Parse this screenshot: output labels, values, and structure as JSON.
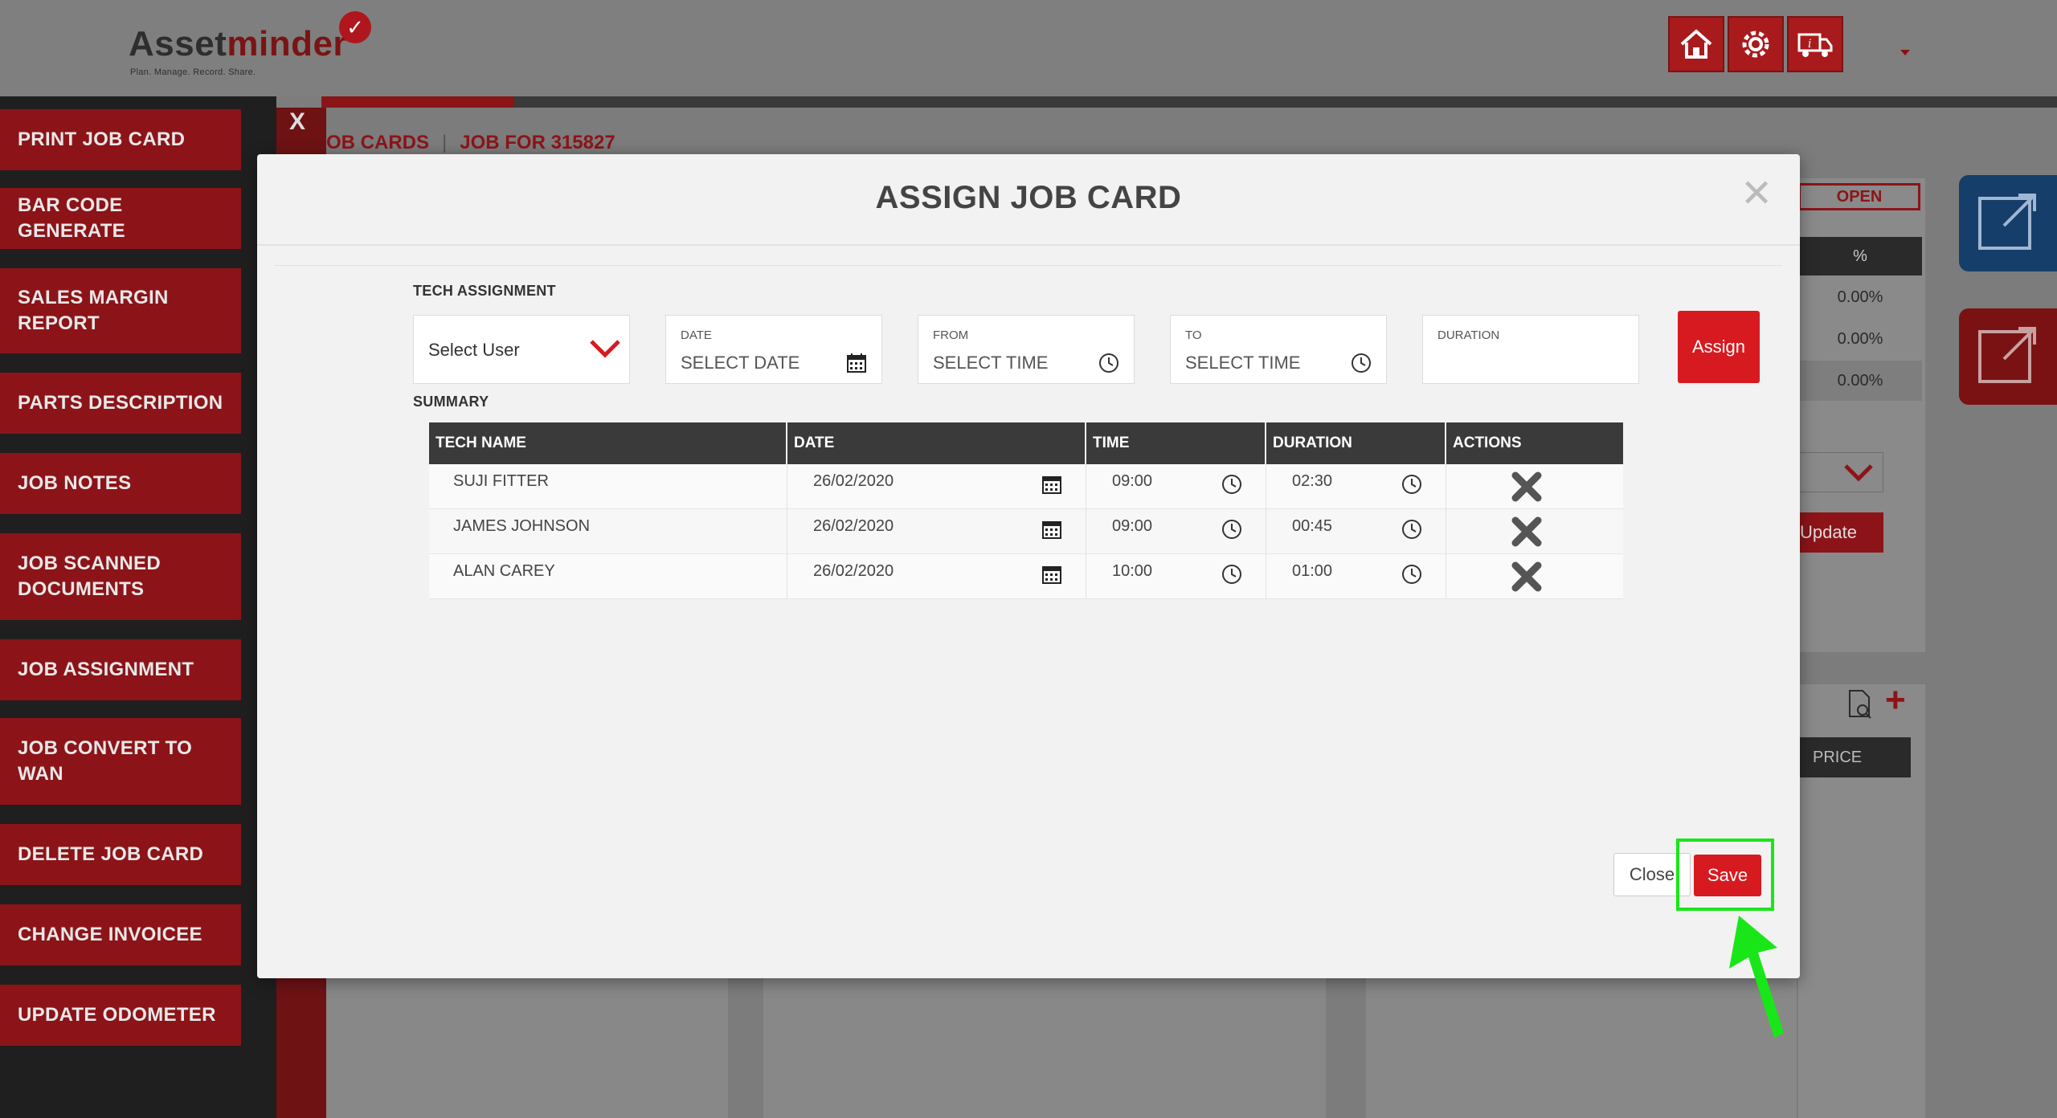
{
  "header": {
    "logo_word_a": "Asset",
    "logo_word_b": "minder",
    "logo_tagline": "Plan. Manage. Record. Share.",
    "nav_icons": [
      "home-icon",
      "gear-icon",
      "truck-info-icon"
    ]
  },
  "sidebar": {
    "close_label": "X",
    "items": [
      {
        "label": "PRINT JOB CARD"
      },
      {
        "label": "BAR CODE GENERATE"
      },
      {
        "label": "SALES MARGIN REPORT"
      },
      {
        "label": "PARTS DESCRIPTION"
      },
      {
        "label": "JOB NOTES"
      },
      {
        "label": "JOB SCANNED DOCUMENTS"
      },
      {
        "label": "JOB ASSIGNMENT"
      },
      {
        "label": "JOB CONVERT TO WAN"
      },
      {
        "label": "DELETE JOB CARD"
      },
      {
        "label": "CHANGE INVOICEE"
      },
      {
        "label": "UPDATE ODOMETER"
      }
    ]
  },
  "breadcrumb": {
    "first": "OB CARDS",
    "second": "JOB FOR 315827"
  },
  "background": {
    "status": "OPEN",
    "pct_header": "%",
    "pct_values": [
      "0.00%",
      "0.00%",
      "0.00%"
    ],
    "update_label": "Update",
    "price_header": "PRICE"
  },
  "modal": {
    "title": "ASSIGN JOB CARD",
    "tech_assignment_label": "TECH ASSIGNMENT",
    "select_user": "Select User",
    "date": {
      "caption": "DATE",
      "placeholder": "SELECT DATE"
    },
    "from": {
      "caption": "FROM",
      "placeholder": "SELECT TIME"
    },
    "to": {
      "caption": "TO",
      "placeholder": "SELECT TIME"
    },
    "duration": {
      "caption": "DURATION",
      "value": ""
    },
    "assign_label": "Assign",
    "summary_label": "SUMMARY",
    "table": {
      "headers": [
        "TECH NAME",
        "DATE",
        "TIME",
        "DURATION",
        "ACTIONS"
      ],
      "rows": [
        {
          "tech": "SUJI FITTER",
          "date": "26/02/2020",
          "time": "09:00",
          "duration": "02:30"
        },
        {
          "tech": "JAMES JOHNSON",
          "date": "26/02/2020",
          "time": "09:00",
          "duration": "00:45"
        },
        {
          "tech": "ALAN CAREY",
          "date": "26/02/2020",
          "time": "10:00",
          "duration": "01:00"
        }
      ]
    },
    "close_label": "Close",
    "save_label": "Save"
  },
  "colors": {
    "brand_red": "#d71a20",
    "dark_red": "#8c1418",
    "highlight_green": "#19e619"
  }
}
